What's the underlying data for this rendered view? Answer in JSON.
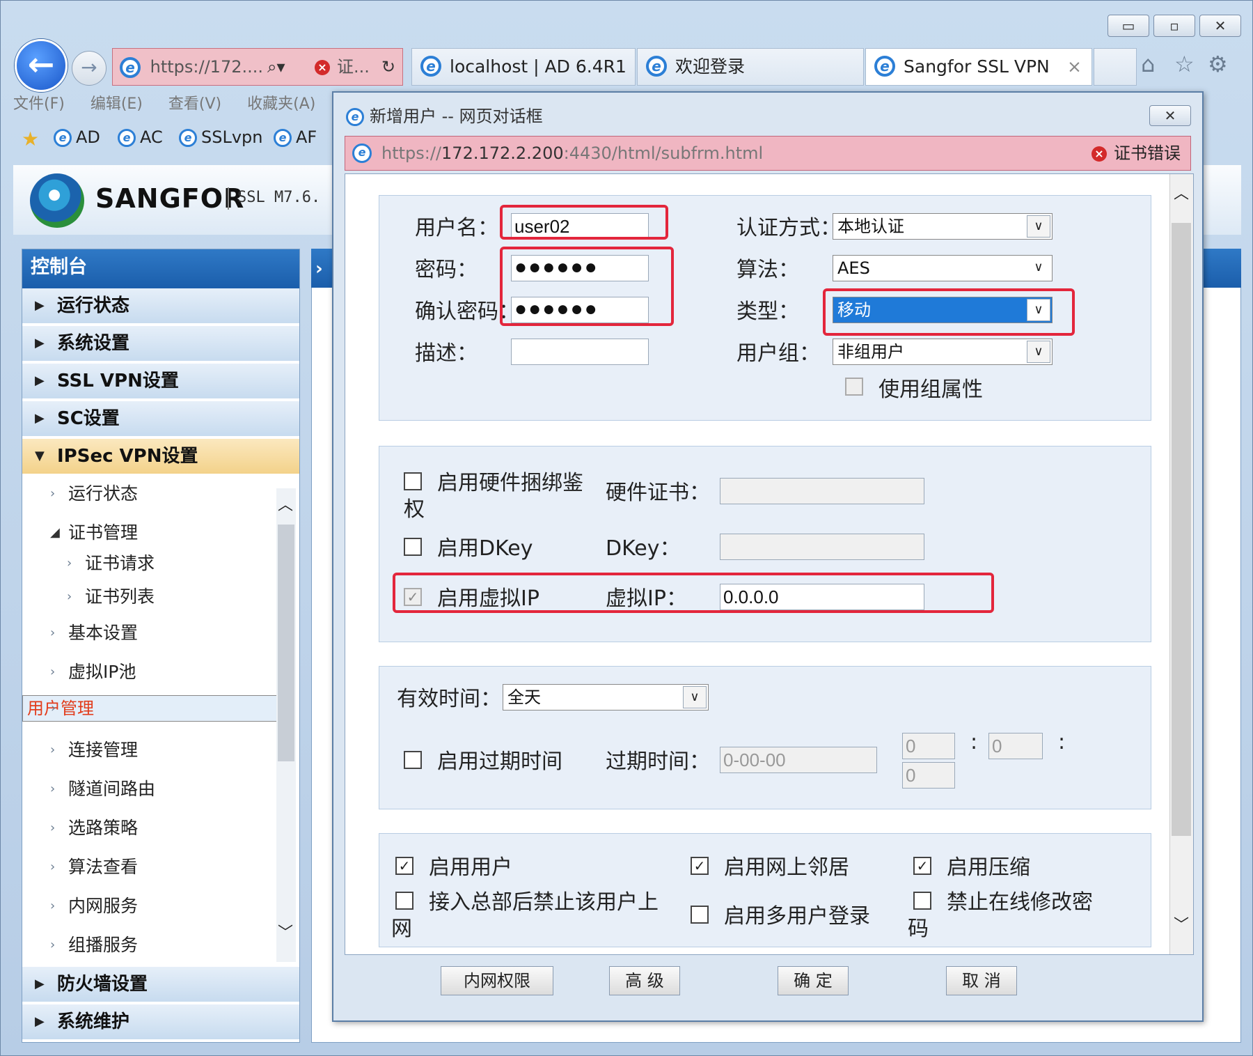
{
  "window_controls": {
    "minimize": "▭",
    "maximize": "▫",
    "close": "✕"
  },
  "browser": {
    "address": "https://172....",
    "address_cert": "证...",
    "tabs": [
      {
        "label": "localhost | AD 6.4R1"
      },
      {
        "label": "欢迎登录"
      },
      {
        "label": "Sangfor SSL VPN",
        "close": "×"
      }
    ],
    "menu": [
      "文件(F)",
      "编辑(E)",
      "查看(V)",
      "收藏夹(A)"
    ],
    "favorites": [
      "AD",
      "AC",
      "SSLvpn",
      "AF"
    ]
  },
  "app": {
    "brand": "SANGFOR",
    "version": "SSL M7.6."
  },
  "sidebar": {
    "title": "控制台",
    "sections": [
      {
        "label": "运行状态"
      },
      {
        "label": "系统设置"
      },
      {
        "label": "SSL VPN设置"
      },
      {
        "label": "SC设置"
      },
      {
        "label": "IPSec VPN设置"
      }
    ],
    "items": [
      {
        "label": "运行状态"
      },
      {
        "label": "证书管理"
      },
      {
        "label": "证书请求"
      },
      {
        "label": "证书列表"
      },
      {
        "label": "基本设置"
      },
      {
        "label": "虚拟IP池"
      },
      {
        "label": "用户管理"
      },
      {
        "label": "连接管理"
      },
      {
        "label": "隧道间路由"
      },
      {
        "label": "选路策略"
      },
      {
        "label": "算法查看"
      },
      {
        "label": "内网服务"
      },
      {
        "label": "组播服务"
      }
    ],
    "bottom_sections": [
      {
        "label": "防火墙设置"
      },
      {
        "label": "系统维护"
      }
    ],
    "colors": {
      "header": "#1f64b0",
      "selected_text": "#e23b1a"
    }
  },
  "dialog": {
    "title": "新增用户 -- 网页对话框",
    "url_prefix": "https://",
    "url_host": "172.172.2.200",
    "url_rest": ":4430/html/subfrm.html",
    "cert_error": "证书错误",
    "form": {
      "username_label": "用户名：",
      "username_value": "user02",
      "password_label": "密码：",
      "password_value": "●●●●●●",
      "confirm_label": "确认密码：",
      "confirm_value": "●●●●●●",
      "desc_label": "描述：",
      "auth_label": "认证方式：",
      "auth_value": "本地认证",
      "algo_label": "算法：",
      "algo_value": "AES",
      "type_label": "类型：",
      "type_value": "移动",
      "group_label": "用户组：",
      "group_value": "非组用户",
      "use_group_label": "使用组属性",
      "hw_bind_label": "启用硬件捆绑鉴",
      "hw_bind_label2": "权",
      "hw_cert_label": "硬件证书：",
      "dkey_enable_label": "启用DKey",
      "dkey_label": "DKey：",
      "vip_enable_label": "启用虚拟IP",
      "vip_label": "虚拟IP：",
      "vip_value": "0.0.0.0",
      "valid_time_label": "有效时间：",
      "valid_time_value": "全天",
      "expire_enable_label": "启用过期时间",
      "expire_label": "过期时间：",
      "expire_date_value": "0-00-00",
      "expire_h": "0",
      "expire_m": "0",
      "expire_s": "0",
      "colon": ":",
      "enable_user_label": "启用用户",
      "enable_neighbor_label": "启用网上邻居",
      "enable_compress_label": "启用压缩",
      "ban_after_hq_label": "接入总部后禁止该用户上",
      "ban_after_hq_label2": "网",
      "multi_login_label": "启用多用户登录",
      "ban_pwd_change_label": "禁止在线修改密",
      "ban_pwd_change_label2": "码"
    },
    "checks": {
      "use_group": false,
      "hw_bind": false,
      "dkey": false,
      "vip": true,
      "expire": false,
      "enable_user": true,
      "enable_neighbor": true,
      "enable_compress": true,
      "ban_after_hq": false,
      "multi_login": false,
      "ban_pwd_change": false
    },
    "buttons": {
      "intranet": "内网权限",
      "advanced": "高 级",
      "ok": "确 定",
      "cancel": "取 消"
    },
    "highlight_color": "#e3263c"
  }
}
